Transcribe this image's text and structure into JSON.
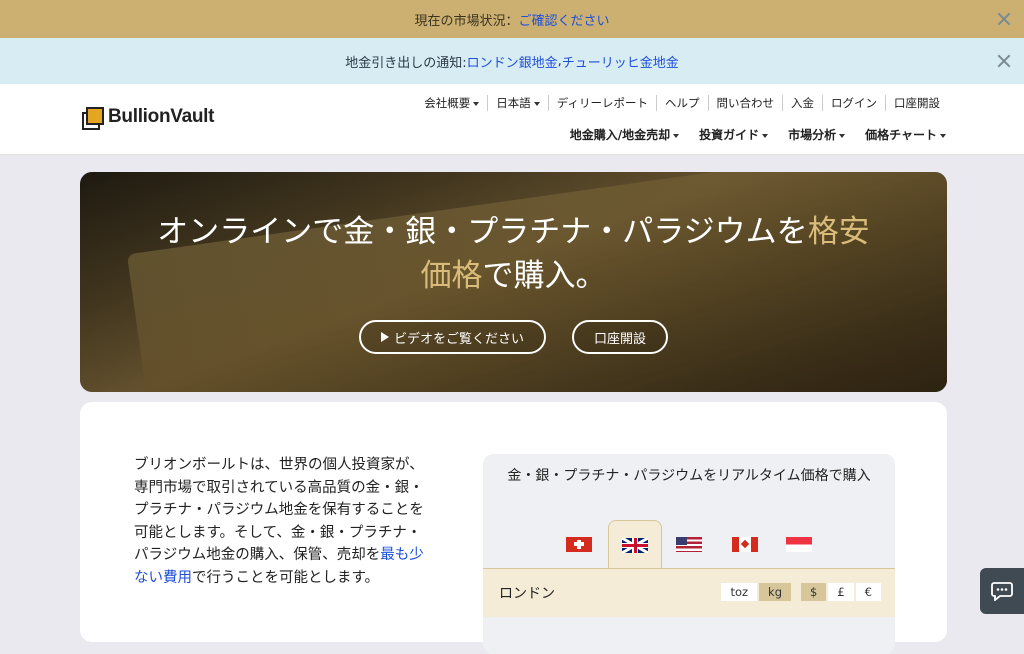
{
  "banners": {
    "market": {
      "prefix": "現在の市場状況：",
      "link": "ご確認ください"
    },
    "notice": {
      "prefix": "地金引き出しの通知: ",
      "link1": "ロンドン銀地金",
      "sep": ",",
      "link2": "チューリッヒ金地金"
    }
  },
  "header": {
    "logo_text": "BullionVault",
    "util_nav": [
      "会社概要",
      "日本語",
      "ディリーレポート",
      "ヘルプ",
      "問い合わせ",
      "入金",
      "ログイン",
      "口座開設"
    ],
    "main_nav": [
      "地金購入/地金売却",
      "投資ガイド",
      "市場分析",
      "価格チャート"
    ]
  },
  "hero": {
    "line1_a": "オンラインで金・銀・プラチナ・パラジウムを",
    "line1_gold": "格安",
    "line2_gold": "価格",
    "line2_b": "で購入。",
    "video_button": "ビデオをご覧ください",
    "open_account_button": "口座開設"
  },
  "intro": {
    "text_a": "ブリオンボールトは、世界の個人投資家が、専門市場で取引されている高品質の金・銀・プラチナ・パラジウム地金を保有することを可能とします。そして、金・銀・プラチナ・パラジウム地金の購入、保管、売却を",
    "link": "最も少ない費用",
    "text_b": "で行うことを可能とします。"
  },
  "prices": {
    "title": "金・銀・プラチナ・パラジウムをリアルタイム価格で購入",
    "flags": [
      "swiss-flag",
      "uk-flag",
      "us-flag",
      "canada-flag",
      "singapore-flag"
    ],
    "active_flag": "uk-flag",
    "location": "ロンドン",
    "weight_units": [
      "toz",
      "kg"
    ],
    "active_weight": "kg",
    "currencies": [
      "$",
      "£",
      "€"
    ],
    "active_currency": "$"
  },
  "colors": {
    "gold_banner": "#ccb072",
    "notice_banner": "#d8ecf4",
    "link": "#1d4fd8",
    "accent_gold": "#d9bc79"
  }
}
